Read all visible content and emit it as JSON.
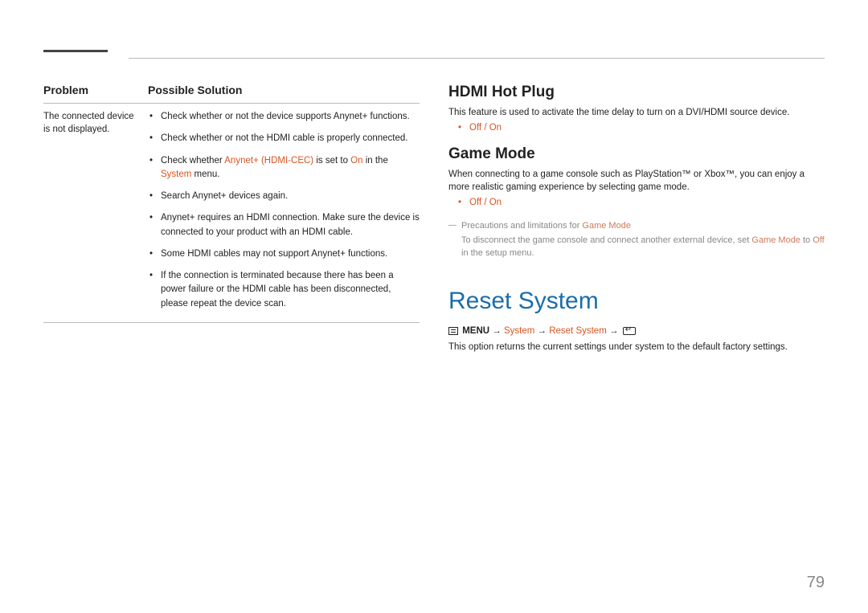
{
  "left": {
    "header_problem": "Problem",
    "header_solution": "Possible Solution",
    "problem_text": "The connected device is not displayed.",
    "sol1": "Check whether or not the device supports Anynet+ functions.",
    "sol2": "Check whether or not the HDMI cable is properly connected.",
    "sol3a": "Check whether ",
    "sol3_link": "Anynet+ (HDMI-CEC)",
    "sol3b": " is set to ",
    "sol3_on": "On",
    "sol3c": " in the ",
    "sol3_system": "System",
    "sol3d": " menu.",
    "sol4": "Search Anynet+ devices again.",
    "sol5": "Anynet+ requires an HDMI connection. Make sure the device is connected to your product with an HDMI cable.",
    "sol6": "Some HDMI cables may not support Anynet+ functions.",
    "sol7": "If the connection is terminated because there has been a power failure or the HDMI cable has been disconnected, please repeat the device scan."
  },
  "right": {
    "hdmi_title": "HDMI Hot Plug",
    "hdmi_desc": "This feature is used to activate the time delay to turn on a DVI/HDMI source device.",
    "off_on": "Off / On",
    "game_title": "Game Mode",
    "game_desc": "When connecting to a game console such as PlayStation™ or Xbox™, you can enjoy a more realistic gaming experience by selecting game mode.",
    "game_note_a": "Precautions and limitations for ",
    "game_note_link": "Game Mode",
    "game_note2_a": "To disconnect the game console and connect another external device, set ",
    "game_note2_gm": "Game Mode",
    "game_note2_b": " to ",
    "game_note2_off": "Off",
    "game_note2_c": " in the setup menu.",
    "reset_title": "Reset System",
    "path_menu": " MENU ",
    "path_arrow": "→",
    "path_system": "System",
    "path_reset": "Reset System",
    "reset_desc": "This option returns the current settings under system to the default factory settings."
  },
  "page_number": "79"
}
